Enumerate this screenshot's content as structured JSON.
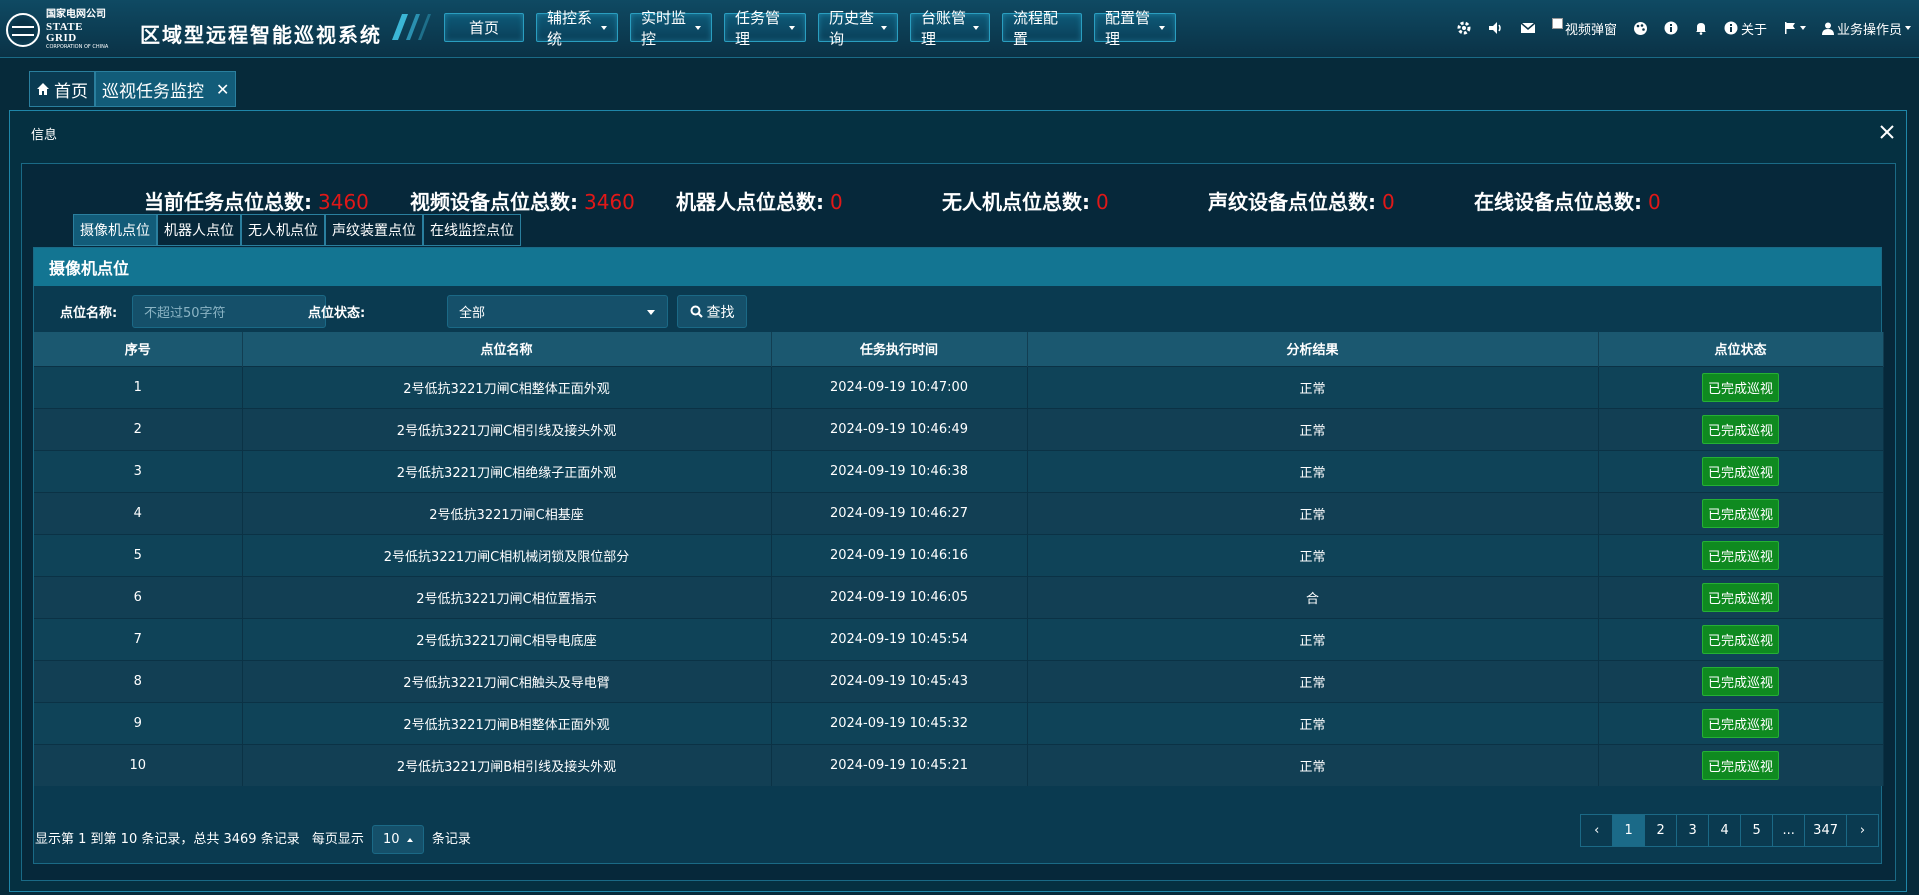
{
  "header": {
    "logo_cn": "国家电网公司",
    "logo_en": "STATE GRID",
    "logo_en_small": "CORPORATION OF CHINA",
    "system_title": "区域型远程智能巡视系统",
    "nav": [
      {
        "label": "首页",
        "has_caret": false
      },
      {
        "label": "辅控系统",
        "has_caret": true
      },
      {
        "label": "实时监控",
        "has_caret": true
      },
      {
        "label": "任务管理",
        "has_caret": true
      },
      {
        "label": "历史查询",
        "has_caret": true
      },
      {
        "label": "台账管理",
        "has_caret": true
      },
      {
        "label": "流程配置",
        "has_caret": false
      },
      {
        "label": "配置管理",
        "has_caret": true
      }
    ],
    "tools": {
      "video_popup_label": "视频弹窗",
      "about_label": "关于",
      "user_label": "业务操作员"
    }
  },
  "tabs": [
    {
      "label": "首页",
      "active": false,
      "icon": "home-icon"
    },
    {
      "label": "巡视任务监控",
      "active": true,
      "closable": true
    }
  ],
  "panel": {
    "title": "信息",
    "stats": [
      {
        "label": "当前任务点位总数:",
        "value": "3460"
      },
      {
        "label": "视频设备点位总数:",
        "value": "3460"
      },
      {
        "label": "机器人点位总数:",
        "value": "0"
      },
      {
        "label": "无人机点位总数:",
        "value": "0"
      },
      {
        "label": "声纹设备点位总数:",
        "value": "0"
      },
      {
        "label": "在线设备点位总数:",
        "value": "0"
      }
    ],
    "subtabs": [
      "摄像机点位",
      "机器人点位",
      "无人机点位",
      "声纹装置点位",
      "在线监控点位"
    ],
    "card_title": "摄像机点位",
    "filter": {
      "name_label": "点位名称:",
      "name_placeholder": "不超过50字符",
      "status_label": "点位状态:",
      "status_value": "全部",
      "search_label": "查找"
    },
    "table": {
      "headers": [
        "序号",
        "点位名称",
        "任务执行时间",
        "分析结果",
        "点位状态"
      ],
      "rows": [
        [
          "1",
          "2号低抗3221刀闸C相整体正面外观",
          "2024-09-19 10:47:00",
          "正常",
          "已完成巡视"
        ],
        [
          "2",
          "2号低抗3221刀闸C相引线及接头外观",
          "2024-09-19 10:46:49",
          "正常",
          "已完成巡视"
        ],
        [
          "3",
          "2号低抗3221刀闸C相绝缘子正面外观",
          "2024-09-19 10:46:38",
          "正常",
          "已完成巡视"
        ],
        [
          "4",
          "2号低抗3221刀闸C相基座",
          "2024-09-19 10:46:27",
          "正常",
          "已完成巡视"
        ],
        [
          "5",
          "2号低抗3221刀闸C相机械闭锁及限位部分",
          "2024-09-19 10:46:16",
          "正常",
          "已完成巡视"
        ],
        [
          "6",
          "2号低抗3221刀闸C相位置指示",
          "2024-09-19 10:46:05",
          "合",
          "已完成巡视"
        ],
        [
          "7",
          "2号低抗3221刀闸C相导电底座",
          "2024-09-19 10:45:54",
          "正常",
          "已完成巡视"
        ],
        [
          "8",
          "2号低抗3221刀闸C相触头及导电臂",
          "2024-09-19 10:45:43",
          "正常",
          "已完成巡视"
        ],
        [
          "9",
          "2号低抗3221刀闸B相整体正面外观",
          "2024-09-19 10:45:32",
          "正常",
          "已完成巡视"
        ],
        [
          "10",
          "2号低抗3221刀闸B相引线及接头外观",
          "2024-09-19 10:45:21",
          "正常",
          "已完成巡视"
        ]
      ]
    },
    "footer": {
      "summary": "显示第 1 到第 10 条记录，总共 3469 条记录",
      "per_page_prefix": "每页显示",
      "per_page_value": "10",
      "per_page_suffix": "条记录",
      "pages": [
        "‹",
        "1",
        "2",
        "3",
        "4",
        "5",
        "...",
        "347",
        "›"
      ],
      "active_page": "1"
    }
  },
  "colors": {
    "accent": "#137592",
    "count_red": "#e01818",
    "status_green": "#0f8a20"
  }
}
